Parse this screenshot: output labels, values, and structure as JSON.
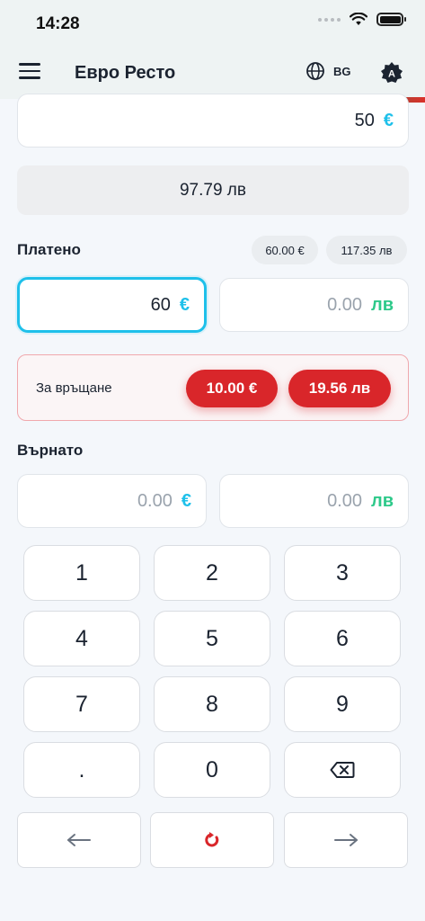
{
  "status_bar": {
    "time": "14:28"
  },
  "header": {
    "title": "Евро Ресто",
    "language": "BG"
  },
  "price": {
    "value": "50",
    "currency_symbol": "€"
  },
  "converted_price": "97.79 лв",
  "paid": {
    "label": "Платено",
    "chips": [
      "60.00 €",
      "117.35 лв"
    ],
    "eur_value": "60",
    "eur_symbol": "€",
    "bgn_value": "0.00",
    "bgn_placeholder": "0.00",
    "bgn_symbol": "лв"
  },
  "change_due": {
    "label": "За връщане",
    "eur": "10.00 €",
    "bgn": "19.56 лв"
  },
  "returned": {
    "label": "Върнато",
    "eur_value": "0.00",
    "eur_symbol": "€",
    "bgn_value": "0.00",
    "bgn_symbol": "лв"
  },
  "keypad": {
    "keys": [
      "1",
      "2",
      "3",
      "4",
      "5",
      "6",
      "7",
      "8",
      "9",
      ".",
      "0"
    ]
  },
  "colors": {
    "eur_accent": "#1ec0ea",
    "bgn_accent": "#2ec98a",
    "change_red": "#d9262a",
    "reset_red": "#d9262a"
  },
  "icons": {
    "menu": "hamburger-icon",
    "language": "globe-icon",
    "theme": "auto-theme-icon",
    "backspace": "backspace-icon",
    "prev": "arrow-left-icon",
    "reset": "reset-icon",
    "next": "arrow-right-icon"
  }
}
